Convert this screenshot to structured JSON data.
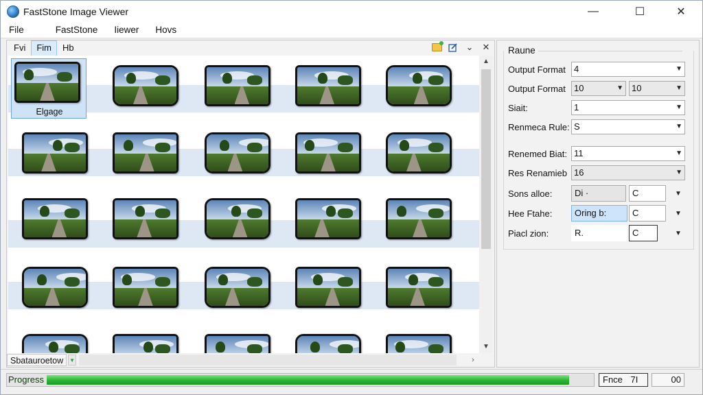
{
  "window": {
    "title": "FastStone Image Viewer",
    "controls": {
      "minimize": "—",
      "maximize": "☐",
      "close": "✕"
    }
  },
  "menu": [
    "File",
    "FastStone",
    "Iiewer",
    "Hovs"
  ],
  "tabs": [
    {
      "label": "Fvi",
      "active": false
    },
    {
      "label": "Fim",
      "active": true
    },
    {
      "label": "Hb",
      "active": false
    }
  ],
  "tab_tools": {
    "chevron": "⌄",
    "close": "✕"
  },
  "thumbnails": {
    "selected_label": "Elgage",
    "count": 25
  },
  "status": {
    "text": "Sbatauroetow",
    "button": "▼"
  },
  "panel": {
    "group_title": "Raune",
    "fields": [
      {
        "label": "Output Format",
        "value": "4"
      },
      {
        "label": "Output Format",
        "value": "10",
        "value2": "10"
      },
      {
        "label": "Siait:",
        "value": "1"
      },
      {
        "label": "Renmeca Rule:",
        "value": "S"
      },
      {
        "label": "Renemed Biat:",
        "value": "11"
      },
      {
        "label": "Res Renamieb",
        "value": "16"
      },
      {
        "label": "Sons alloe:",
        "value": "Di ·",
        "value2": "C"
      },
      {
        "label": "Hee Ftahe:",
        "value": "Oring b:",
        "value2": "C"
      },
      {
        "label": "Piacl zion:",
        "value": "R.",
        "value2": "C"
      }
    ]
  },
  "progress": {
    "label": "Progress",
    "fraction": 0.955,
    "box1": "Fnce",
    "box1_suffix": "7I",
    "box2": "00"
  },
  "colors": {
    "selection": "#cfe3f7",
    "row_band": "#dde8f4",
    "progress_green": "#2bb534"
  }
}
